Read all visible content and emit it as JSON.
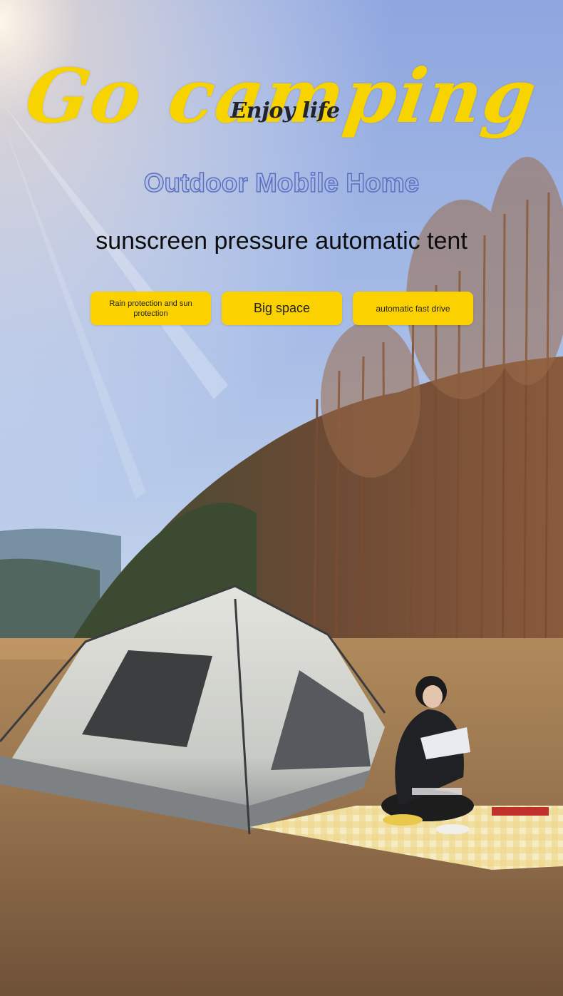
{
  "poster": {
    "script_title": "Go camping",
    "script_subtitle": "Enjoy life",
    "outline_title": "Outdoor Mobile Home",
    "tagline": "sunscreen pressure automatic tent"
  },
  "features": [
    {
      "label": "Rain protection and sun protection"
    },
    {
      "label": "Big space"
    },
    {
      "label": "automatic fast drive"
    }
  ],
  "colors": {
    "accent_yellow": "#fbd200",
    "outline_blue": "#5d6ec0",
    "sky_top": "#8fa6de",
    "ground": "#8a6a49"
  }
}
